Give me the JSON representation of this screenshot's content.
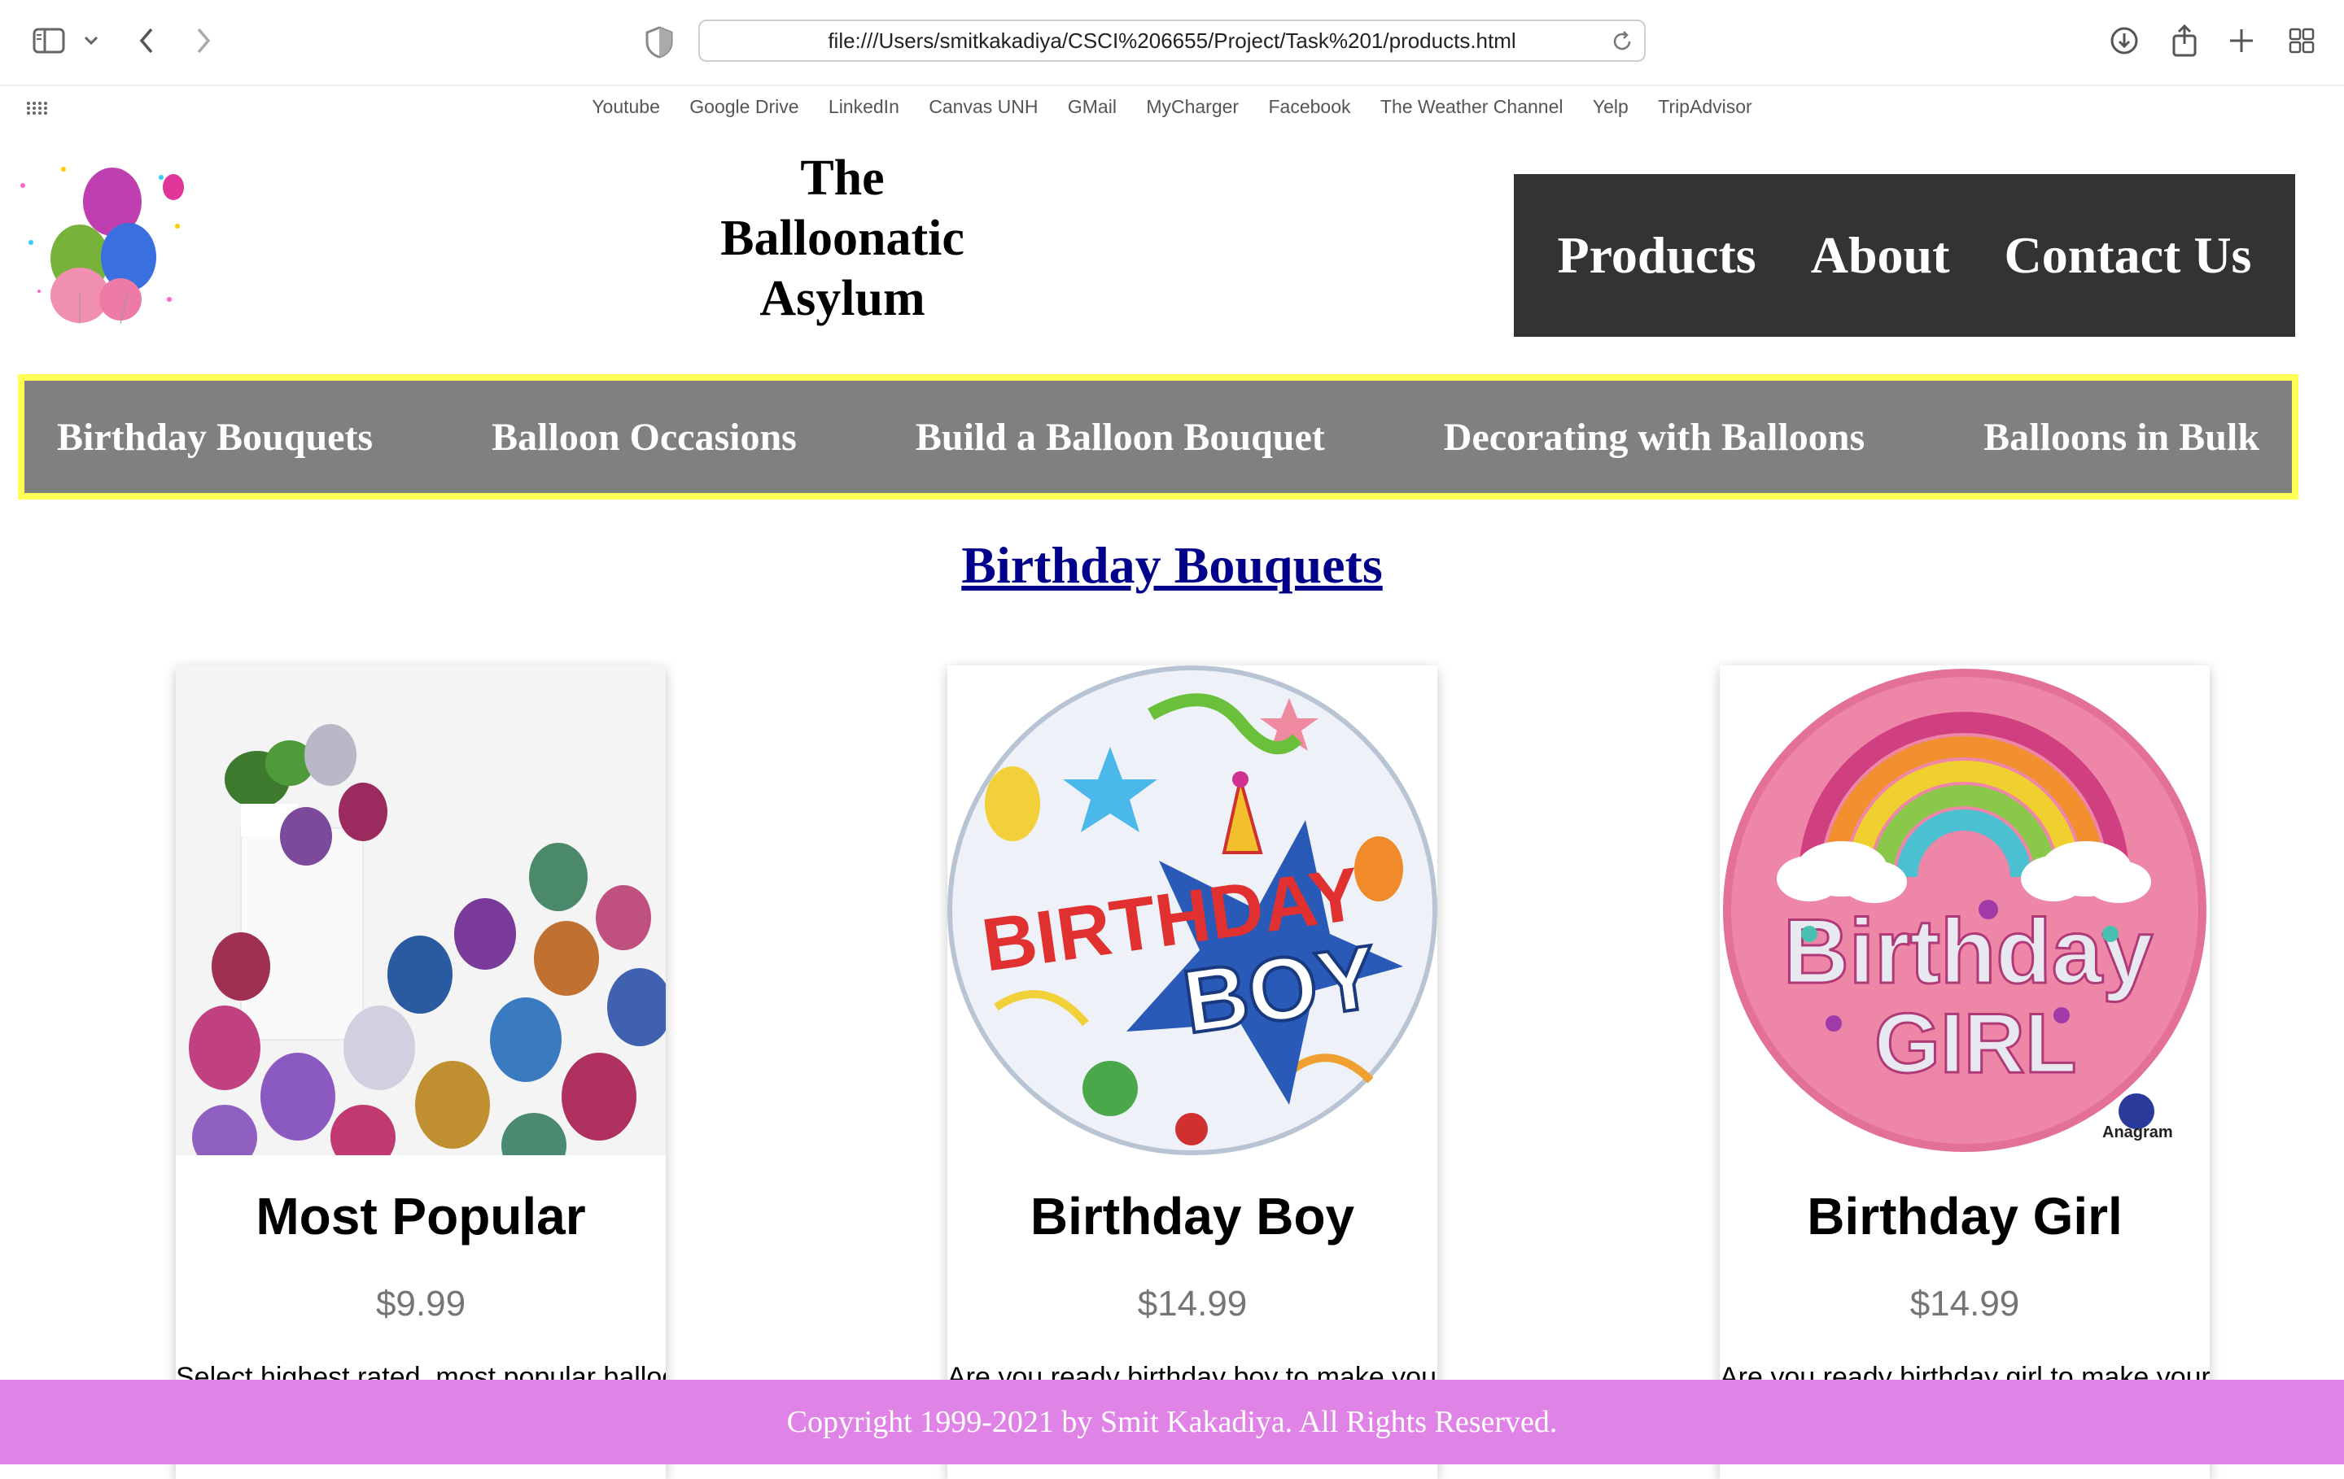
{
  "browser": {
    "url": "file:///Users/smitkakadiya/CSCI%206655/Project/Task%201/products.html",
    "icons": [
      "sidebar-icon",
      "chevron-down-icon",
      "back-icon",
      "forward-icon",
      "shield-icon",
      "reload-icon",
      "download-icon",
      "share-icon",
      "new-tab-icon",
      "tab-overview-icon"
    ],
    "favorites": [
      "Youtube",
      "Google Drive",
      "LinkedIn",
      "Canvas UNH",
      "GMail",
      "MyCharger",
      "Facebook",
      "The Weather Channel",
      "Yelp",
      "TripAdvisor"
    ]
  },
  "header": {
    "logo_text": "The BALLOONATIC ASYLUM",
    "title_line1": "The",
    "title_line2": "Balloonatic",
    "title_line3": "Asylum",
    "nav": [
      "Products",
      "About",
      "Contact Us"
    ],
    "nav_bg": "#333333"
  },
  "categories": {
    "items": [
      "Birthday Bouquets",
      "Balloon Occasions",
      "Build a Balloon Bouquet",
      "Decorating with Balloons",
      "Balloons in Bulk"
    ],
    "bg": "#808080",
    "border": "#ffff55"
  },
  "section": {
    "heading": "Birthday Bouquets",
    "color": "#00008b"
  },
  "products": [
    {
      "name": "Most Popular",
      "price": "$9.99",
      "desc": "Select highest rated, most popular balloon",
      "image": "metallic-balloons-image"
    },
    {
      "name": "Birthday Boy",
      "price": "$14.99",
      "desc": "Are you ready birthday boy to make your",
      "image": "birthday-boy-balloon-image",
      "image_text_1": "BIRTHDAY",
      "image_text_2": "BOY"
    },
    {
      "name": "Birthday Girl",
      "price": "$14.99",
      "desc": "Are you ready birthday girl to make your",
      "image": "birthday-girl-balloon-image",
      "image_text_1": "Birthday",
      "image_text_2": "GIRL",
      "image_brand": "Anagram"
    }
  ],
  "footer": {
    "text": "Copyright 1999-2021 by Smit Kakadiya. All Rights Reserved.",
    "bg": "#e083e6"
  }
}
